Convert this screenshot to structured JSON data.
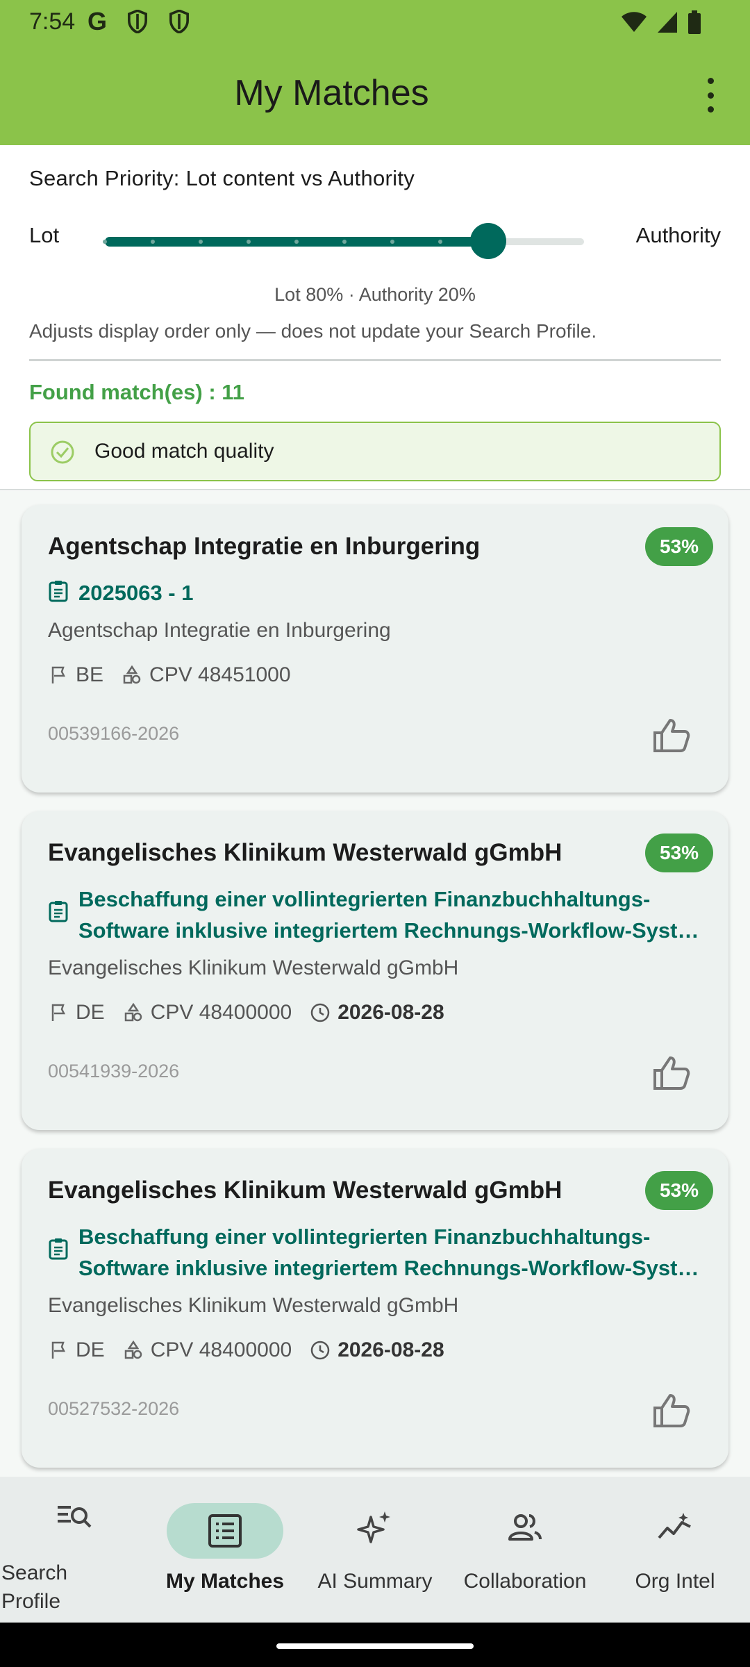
{
  "status_bar": {
    "time": "7:54",
    "g_label": "G",
    "icons": [
      "shield-icon",
      "shield-icon",
      "wifi-icon",
      "signal-icon",
      "battery-icon"
    ]
  },
  "app_bar": {
    "title": "My Matches",
    "menu_icon": "more-vert-icon"
  },
  "priority": {
    "title": "Search Priority: Lot content vs Authority",
    "left_label": "Lot",
    "right_label": "Authority",
    "slider_value": 0.8,
    "values_text": "Lot 80%  ·  Authority 20%",
    "note": "Adjusts display order only — does not update your Search Profile."
  },
  "found_text": "Found match(es) : 11",
  "quality": {
    "text": "Good match quality",
    "icon": "check-circle-icon"
  },
  "cards": [
    {
      "title": "Agentschap Integratie en Inburgering",
      "score": "53%",
      "lot_line1": "2025063 - 1",
      "lot_line2": "",
      "authority": "Agentschap Integratie en Inburgering",
      "country": "BE",
      "cpv": "CPV 48451000",
      "deadline": "",
      "ref": "00539166-2026"
    },
    {
      "title": "Evangelisches Klinikum Westerwald gGmbH",
      "score": "53%",
      "lot_line1": "Beschaffung einer vollintegrierten Finanzbuchhaltungs-",
      "lot_line2": "Software inklusive integriertem Rechnungs-Workflow-System",
      "authority": "Evangelisches Klinikum Westerwald gGmbH",
      "country": "DE",
      "cpv": "CPV 48400000",
      "deadline": "2026-08-28",
      "ref": "00541939-2026"
    },
    {
      "title": "Evangelisches Klinikum Westerwald gGmbH",
      "score": "53%",
      "lot_line1": "Beschaffung einer vollintegrierten Finanzbuchhaltungs-",
      "lot_line2": "Software inklusive integriertem Rechnungs-Workflow-System",
      "authority": "Evangelisches Klinikum Westerwald gGmbH",
      "country": "DE",
      "cpv": "CPV 48400000",
      "deadline": "2026-08-28",
      "ref": "00527532-2026"
    }
  ],
  "nav": [
    {
      "label_line1": "Search",
      "label_line2": "Profile",
      "icon": "search-list-icon"
    },
    {
      "label": "My Matches",
      "icon": "list-alt-icon",
      "active": true
    },
    {
      "label": "AI Summary",
      "icon": "sparkle-icon"
    },
    {
      "label": "Collaboration",
      "icon": "people-icon"
    },
    {
      "label": "Org Intel",
      "icon": "insights-icon"
    }
  ],
  "colors": {
    "app_bar": "#8bc34a",
    "accent": "#00695c",
    "badge": "#43a047",
    "found": "#43a047"
  }
}
